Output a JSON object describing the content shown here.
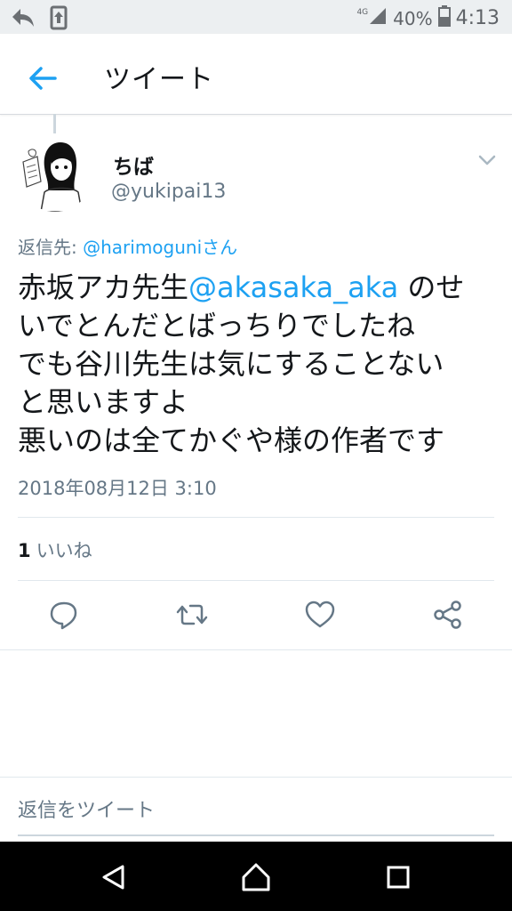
{
  "status_bar": {
    "network": "4G",
    "battery": "40%",
    "time": "4:13"
  },
  "app_bar": {
    "title": "ツイート"
  },
  "tweet": {
    "display_name": "ちば",
    "handle": "@yukipai13",
    "reply_prefix": "返信先: ",
    "reply_mention": "@harimoguniさん",
    "body": {
      "line1_before": "赤坂アカ先生",
      "line1_mention": "@akasaka_aka",
      "line1_after": " のせ",
      "line2": "いでとんだとばっちりでしたね",
      "line3": "でも谷川先生は気にすることない",
      "line4": "と思いますよ",
      "line5": "悪いのは全てかぐや様の作者です"
    },
    "timestamp": "2018年08月12日 3:10",
    "likes_count": "1",
    "likes_label": "いいね"
  },
  "reply": {
    "placeholder": "返信をツイート"
  },
  "colors": {
    "accent": "#1da1f2",
    "secondary_text": "#657786",
    "divider": "#e1e8ed"
  }
}
